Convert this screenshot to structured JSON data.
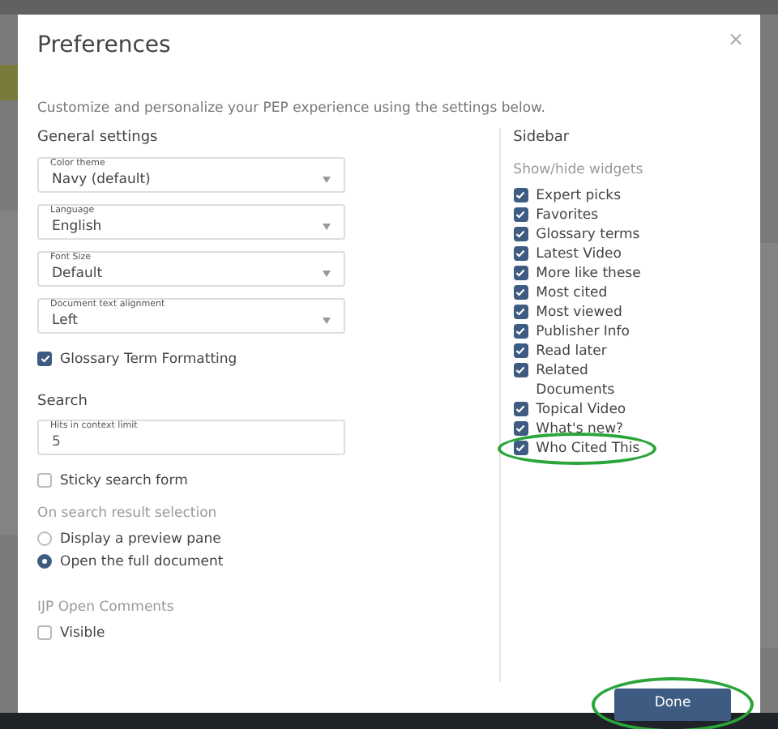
{
  "dialog": {
    "title": "Preferences",
    "close": "×",
    "description": "Customize and personalize your PEP experience using the settings below.",
    "general": {
      "heading": "General settings",
      "selects": [
        {
          "label": "Color theme",
          "value": "Navy (default)"
        },
        {
          "label": "Language",
          "value": "English"
        },
        {
          "label": "Font Size",
          "value": "Default"
        },
        {
          "label": "Document text alignment",
          "value": "Left"
        }
      ],
      "glossary": {
        "label": "Glossary Term Formatting",
        "checked": true
      }
    },
    "search": {
      "heading": "Search",
      "hits_field": {
        "label": "Hits in context limit",
        "value": "5"
      },
      "sticky": {
        "label": "Sticky search form",
        "checked": false
      },
      "result_heading": "On search result selection",
      "result_options": [
        {
          "label": "Display a preview pane",
          "selected": false
        },
        {
          "label": "Open the full document",
          "selected": true
        }
      ]
    },
    "comments": {
      "heading": "IJP Open Comments",
      "visible": {
        "label": "Visible",
        "checked": false
      }
    },
    "sidebar": {
      "heading": "Sidebar",
      "subheading": "Show/hide widgets",
      "widgets": [
        {
          "label": "Expert picks",
          "checked": true,
          "circled": false
        },
        {
          "label": "Favorites",
          "checked": true,
          "circled": false
        },
        {
          "label": "Glossary terms",
          "checked": true,
          "circled": false
        },
        {
          "label": "Latest Video",
          "checked": true,
          "circled": false
        },
        {
          "label": "More like these",
          "checked": true,
          "circled": false
        },
        {
          "label": "Most cited",
          "checked": true,
          "circled": false
        },
        {
          "label": "Most viewed",
          "checked": true,
          "circled": false
        },
        {
          "label": "Publisher Info",
          "checked": true,
          "circled": false
        },
        {
          "label": "Read later",
          "checked": true,
          "circled": false
        },
        {
          "label": "Related Documents",
          "checked": true,
          "circled": false
        },
        {
          "label": "Topical Video",
          "checked": true,
          "circled": false
        },
        {
          "label": "What's new?",
          "checked": true,
          "circled": false
        },
        {
          "label": "Who Cited This",
          "checked": true,
          "circled": true
        }
      ]
    },
    "done_button": {
      "label": "Done",
      "circled": true
    }
  }
}
